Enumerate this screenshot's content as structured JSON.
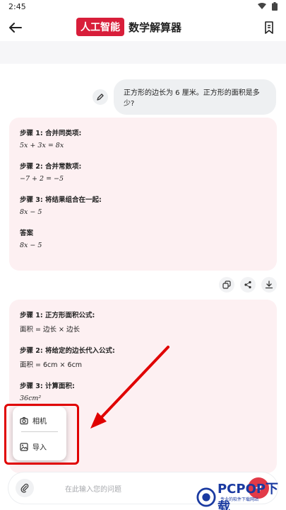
{
  "status": {
    "time": "2:45"
  },
  "appbar": {
    "badge": "人工智能",
    "title": "数学解算器"
  },
  "user_message": "正方形的边长为 6 厘米。正方形的面积是多少?",
  "card1": {
    "steps": [
      {
        "heading": "步骤 1: 合并同类项:",
        "equation": "5x + 3x = 8x"
      },
      {
        "heading": "步骤 2: 合并常数项:",
        "equation": "−7 + 2 = −5"
      },
      {
        "heading": "步骤 3: 将结果组合在一起:",
        "equation": "8x − 5"
      },
      {
        "heading": "答案",
        "equation": "8x − 5"
      }
    ]
  },
  "card2": {
    "steps": [
      {
        "heading": "步骤 1: 正方形面积公式:",
        "equation": "面积 = 边长 × 边长"
      },
      {
        "heading": "步骤 2: 将给定的边长代入公式:",
        "equation": "面积 = 6cm × 6cm"
      },
      {
        "heading": "步骤 3: 计算面积:",
        "equation": "36cm²"
      }
    ]
  },
  "popup": {
    "camera_label": "相机",
    "import_label": "导入"
  },
  "input": {
    "placeholder": "在此输入您的问题"
  },
  "watermark": {
    "text": "PCPOP下载",
    "sub": "专业的软件下载网站"
  },
  "colors": {
    "accent": "#d81e3a",
    "card_bg": "#fdf0f2",
    "highlight": "#e00000"
  }
}
